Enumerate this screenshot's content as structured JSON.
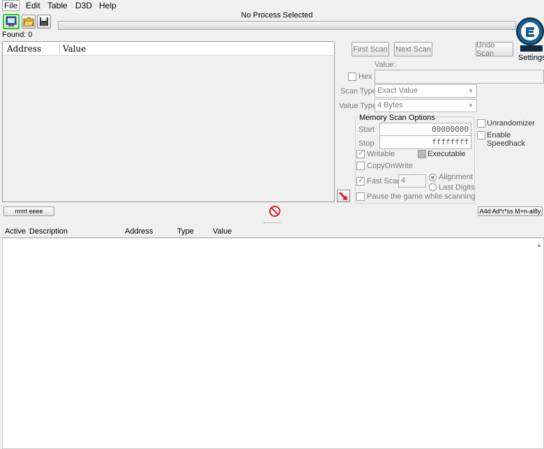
{
  "menu": {
    "file": "File",
    "edit": "Edit",
    "table": "Table",
    "d3d": "D3D",
    "help": "Help"
  },
  "toolbar": {
    "open_process_icon": "computer-icon",
    "open_file_icon": "folder-icon",
    "save_icon": "floppy-icon"
  },
  "process_title": "No Process Selected",
  "found_label": "Found: 0",
  "results": {
    "columns": [
      "Address",
      "Value"
    ]
  },
  "scan": {
    "first_scan": "First Scan",
    "next_scan": "Next Scan",
    "undo_scan": "Undo Scan",
    "settings": "Settings",
    "value_label": "Value:",
    "hex_label": "Hex",
    "scan_type_label": "Scan Type",
    "scan_type_value": "Exact Value",
    "value_type_label": "Value Type",
    "value_type_value": "4 Bytes"
  },
  "memory_options": {
    "title": "Memory Scan Options",
    "start_label": "Start",
    "start_value": "00000000",
    "stop_label": "Stop",
    "stop_value": "ffffffff",
    "writable": "Writable",
    "executable": "Executable",
    "copy_on_write": "CopyOnWrite",
    "fast_scan": "Fast Scan",
    "fast_scan_value": "4",
    "alignment": "Alignment",
    "last_digits": "Last Digits",
    "pause_game": "Pause the game while scanning"
  },
  "extra_options": {
    "unrandomizer": "Unrandomizer",
    "enable_speedhack": "Enable Speedhack"
  },
  "memory_view_button": "rrrrrt eeee",
  "add_address_button": "A4d Ad*r*ss M+n-al8y",
  "address_list": {
    "columns": [
      "Active",
      "Description",
      "Address",
      "Type",
      "Value"
    ]
  },
  "colors": {
    "highlight_green": "#22cc22",
    "logo_blue": "#1a5d8c",
    "stop_red": "#d81e1e"
  }
}
